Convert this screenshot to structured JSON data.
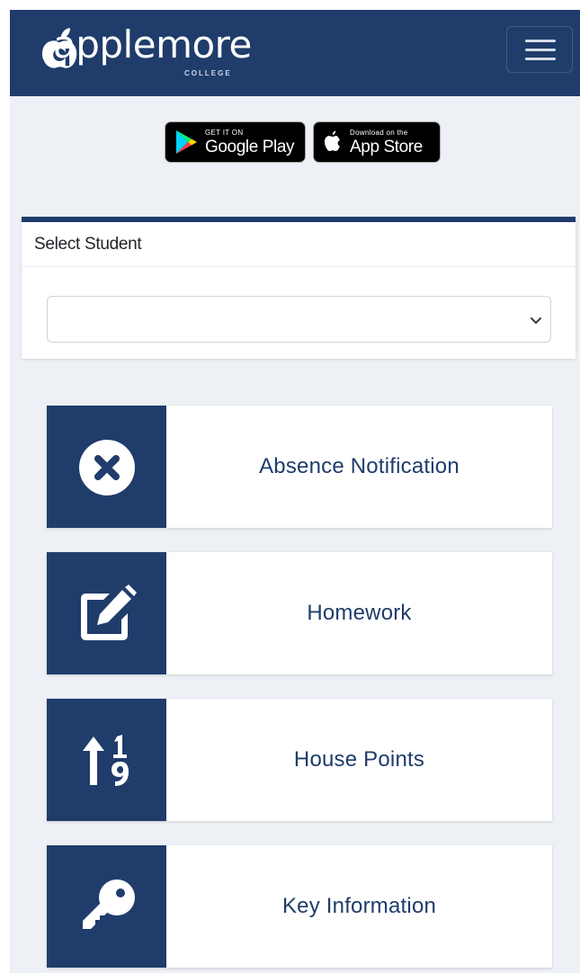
{
  "brand": {
    "name": "applemore",
    "subtitle": "COLLEGE",
    "colors": {
      "primary": "#1f3c6b",
      "background": "#edf0f5"
    }
  },
  "header": {
    "menu_icon": "hamburger-icon"
  },
  "stores": {
    "google": {
      "small": "GET IT ON",
      "big": "Google Play"
    },
    "apple": {
      "small": "Download on the",
      "big": "App Store"
    }
  },
  "student_select": {
    "title": "Select Student",
    "selected_value": ""
  },
  "tiles": [
    {
      "label": "Absence Notification",
      "icon": "times-circle-icon"
    },
    {
      "label": "Homework",
      "icon": "edit-icon"
    },
    {
      "label": "House Points",
      "icon": "sort-numeric-up-icon"
    },
    {
      "label": "Key Information",
      "icon": "key-icon"
    }
  ]
}
